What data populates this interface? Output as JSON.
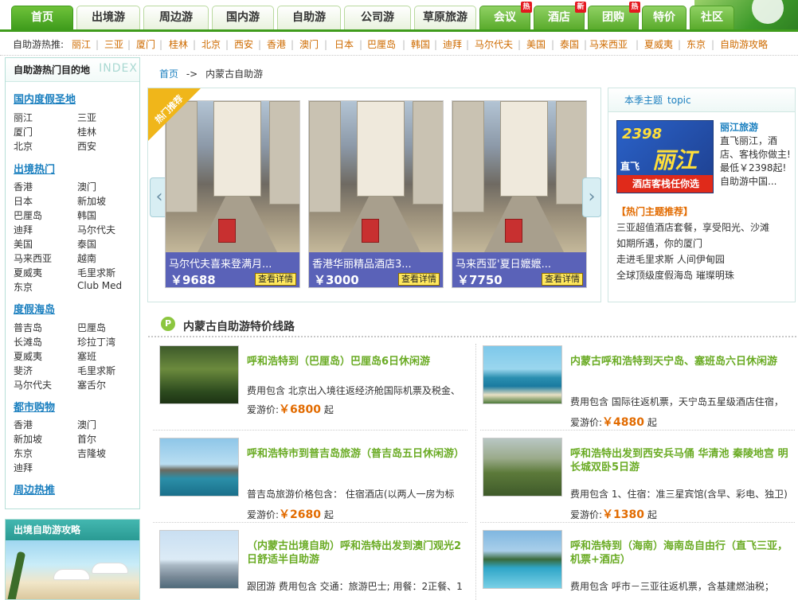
{
  "nav": {
    "tabs": [
      "首页",
      "出境游",
      "周边游",
      "国内游",
      "自助游",
      "公司游",
      "草原旅游",
      "会议",
      "酒店",
      "团购",
      "特价",
      "社区"
    ],
    "badges": [
      "热",
      "新",
      "热"
    ]
  },
  "hot": {
    "label": "自助游热推:",
    "items": [
      "丽江",
      "三亚",
      "厦门",
      "桂林",
      "北京",
      "西安",
      "香港",
      "澳门",
      "日本",
      "巴厘岛",
      "韩国",
      "迪拜",
      "马尔代夫",
      "美国",
      "泰国",
      "马来西亚",
      "夏威夷",
      "东京",
      "自助游攻略"
    ]
  },
  "sidebar": {
    "title": "自助游热门目的地",
    "index": "INDEX",
    "cats": [
      {
        "name": "国内度假圣地",
        "dests": [
          "丽江",
          "三亚",
          "厦门",
          "桂林",
          "北京",
          "西安"
        ]
      },
      {
        "name": "出境热门",
        "dests": [
          "香港",
          "澳门",
          "日本",
          "新加坡",
          "巴厘岛",
          "韩国",
          "迪拜",
          "马尔代夫",
          "美国",
          "泰国",
          "马来西亚",
          "越南",
          "夏威夷",
          "毛里求斯",
          "东京",
          "Club Med"
        ]
      },
      {
        "name": "度假海岛",
        "dests": [
          "普吉岛",
          "巴厘岛",
          "长滩岛",
          "珍拉丁湾",
          "夏威夷",
          "塞班",
          "斐济",
          "毛里求斯",
          "马尔代夫",
          "塞舌尔"
        ]
      },
      {
        "name": "都市购物",
        "dests": [
          "香港",
          "澳门",
          "新加坡",
          "首尔",
          "东京",
          "吉隆坡",
          "迪拜"
        ]
      },
      {
        "name": "周边热推",
        "dests": []
      }
    ],
    "guide_title": "出境自助游攻略"
  },
  "breadcrumb": {
    "home": "首页",
    "sep": "->",
    "current": "内蒙古自助游"
  },
  "featured": {
    "ribbon": "热门推荐",
    "slides": [
      {
        "title": "马尔代夫喜来登满月...",
        "price": "￥9688",
        "btn": "查看详情"
      },
      {
        "title": "香港华丽精品酒店3...",
        "price": "￥3000",
        "btn": "查看详情"
      },
      {
        "title": "马来西亚'夏日嬷嬷...",
        "price": "￥7750",
        "btn": "查看详情"
      }
    ],
    "prev": "‹",
    "next": "›"
  },
  "topic": {
    "heading": "本季主题",
    "heading_en": "topic",
    "ad": {
      "price": "2398",
      "big": "丽江",
      "zf": "直飞",
      "sub": "酒店客栈任你选"
    },
    "title": "丽江旅游",
    "desc": "直飞丽江，酒店、客栈你做主!最低￥2398起!自助游中国...",
    "rec": "【热门主题推荐】",
    "items": [
      "三亚超值酒店套餐，享受阳光、沙滩",
      "如期所遇，你的厦门",
      "走进毛里求斯 人间伊甸园",
      "全球顶级度假海岛 璀璨明珠"
    ]
  },
  "section": {
    "icon": "P",
    "title": "内蒙古自助游特价线路"
  },
  "routes": [
    {
      "title": "呼和浩特到（巴厘岛）巴厘岛6日休闲游",
      "desc": "费用包含 北京出入境往返经济舱国际机票及税金、",
      "price_label": "爱游价:",
      "price": "￥6800",
      "unit": "起"
    },
    {
      "title": "内蒙古呼和浩特到天宁岛、塞班岛六日休闲游",
      "desc": "费用包含 国际往返机票，天宁岛五星级酒店住宿，",
      "price_label": "爱游价:",
      "price": "￥4880",
      "unit": "起"
    },
    {
      "title": "呼和浩特市到普吉岛旅游（普吉岛五日休闲游）",
      "desc": "普吉岛旅游价格包含： 住宿酒店(以两人一房为标",
      "price_label": "爱游价:",
      "price": "￥2680",
      "unit": "起"
    },
    {
      "title": "呼和浩特出发到西安兵马俑 华清池 秦陵地宫 明长城双卧5日游",
      "desc": "费用包含 1、住宿：准三星宾馆(含早、彩电、独卫)",
      "price_label": "爱游价:",
      "price": "￥1380",
      "unit": "起"
    },
    {
      "title": "（内蒙古出境自助）呼和浩特出发到澳门观光2日舒适半自助游",
      "desc": "跟团游 费用包含 交通：旅游巴士; 用餐：2正餐、1",
      "price_label": "",
      "price": "",
      "unit": ""
    },
    {
      "title": "呼和浩特到（海南）海南岛自由行（直飞三亚，机票+酒店）",
      "desc": "费用包含 呼市－三亚往返机票，含基建燃油税；",
      "price_label": "",
      "price": "",
      "unit": ""
    }
  ]
}
